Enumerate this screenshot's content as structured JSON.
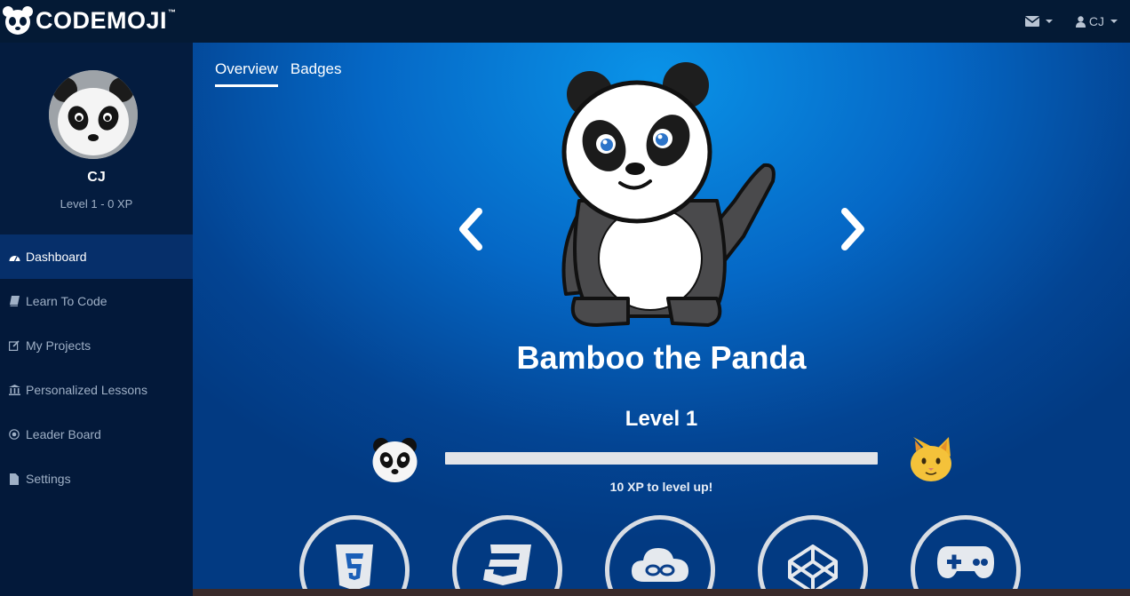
{
  "app": {
    "logo_text": "CODEMOJI",
    "logo_tm": "™"
  },
  "topbar": {
    "mail_icon": "envelope-icon",
    "user_label": "CJ",
    "user_icon": "user-icon"
  },
  "profile": {
    "name": "CJ",
    "level_text": "Level 1 - 0 XP"
  },
  "sidebar": {
    "items": [
      {
        "label": "Dashboard",
        "icon": "dashboard-icon",
        "active": true
      },
      {
        "label": "Learn To Code",
        "icon": "book-icon"
      },
      {
        "label": "My Projects",
        "icon": "edit-icon"
      },
      {
        "label": "Personalized Lessons",
        "icon": "institution-icon"
      },
      {
        "label": "Leader Board",
        "icon": "target-icon"
      },
      {
        "label": "Settings",
        "icon": "file-icon"
      }
    ]
  },
  "tabs": [
    {
      "label": "Overview",
      "active": true
    },
    {
      "label": "Badges"
    }
  ],
  "character": {
    "name": "Bamboo the Panda"
  },
  "level": {
    "title": "Level 1",
    "progress": 0,
    "xp_text": "10 XP to level up!"
  },
  "badges": [
    {
      "icon": "html5-icon"
    },
    {
      "icon": "css3-icon"
    },
    {
      "icon": "cloud-link-icon"
    },
    {
      "icon": "codepen-icon"
    },
    {
      "icon": "gamepad-icon"
    }
  ],
  "colors": {
    "topbar": "#041a35",
    "sidebar": "#03193a",
    "active_nav": "#062f6a",
    "main_blue": "#0568c6"
  }
}
